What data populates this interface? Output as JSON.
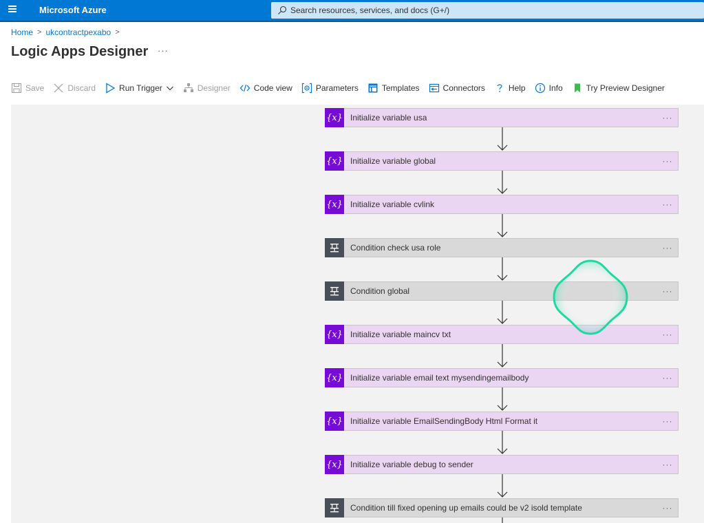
{
  "topbar": {
    "brand": "Microsoft Azure",
    "search_placeholder": "Search resources, services, and docs (G+/)"
  },
  "breadcrumb": {
    "items": [
      "Home",
      "ukcontractpexabo"
    ],
    "separator": ">"
  },
  "page": {
    "title": "Logic Apps Designer",
    "more": "···"
  },
  "toolbar": {
    "save": "Save",
    "discard": "Discard",
    "run_trigger": "Run Trigger",
    "designer": "Designer",
    "code_view": "Code view",
    "parameters": "Parameters",
    "templates": "Templates",
    "connectors": "Connectors",
    "help": "Help",
    "info": "Info",
    "try_preview": "Try Preview Designer"
  },
  "flow": {
    "actions": [
      {
        "type": "variable",
        "label": "Initialize variable usa"
      },
      {
        "type": "variable",
        "label": "Initialize variable global"
      },
      {
        "type": "variable",
        "label": "Initialize variable cvlink"
      },
      {
        "type": "condition",
        "label": "Condition check usa role"
      },
      {
        "type": "condition",
        "label": "Condition global"
      },
      {
        "type": "variable",
        "label": "Initialize variable maincv txt"
      },
      {
        "type": "variable",
        "label": "Initialize variable email text mysendingemailbody"
      },
      {
        "type": "variable",
        "label": "Initialize variable EmailSendingBody Html Format it"
      },
      {
        "type": "variable",
        "label": "Initialize variable debug to sender"
      },
      {
        "type": "condition",
        "label": "Condition till fixed opening up emails could be v2 isold template"
      }
    ],
    "variable_icon_text": "{x}",
    "more_label": "···"
  },
  "colors": {
    "azure_blue": "#0078d4",
    "variable_fill": "#ead6f2",
    "variable_icon": "#770bd6",
    "condition_fill": "#d9d9d9",
    "condition_icon": "#484f58",
    "cursor_ring": "#1fd8a0"
  }
}
